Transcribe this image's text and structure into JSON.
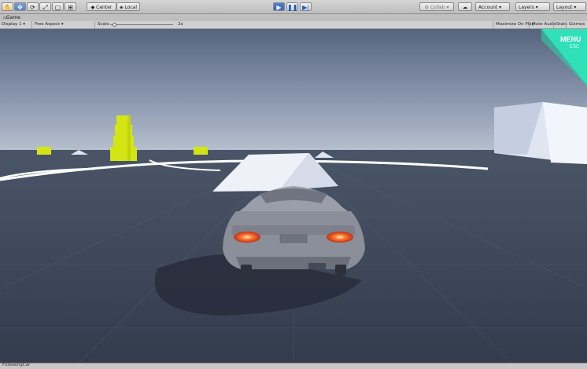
{
  "toolbar": {
    "tools": [
      "hand-tool",
      "move-tool",
      "rotate-tool",
      "scale-tool",
      "rect-tool",
      "transform-tool"
    ],
    "pivot_label": "Center",
    "space_label": "Local",
    "playback": [
      "play-button",
      "pause-button",
      "step-button"
    ],
    "collab_label": "Collab",
    "account_label": "Account",
    "layers_label": "Layers",
    "layout_label": "Layout"
  },
  "tab": {
    "title": "Game"
  },
  "game_bar": {
    "display": "Display 1",
    "aspect": "Free Aspect",
    "scale_label": "Scale",
    "scale_value": "2x",
    "maximize": "Maximize On Play",
    "mute": "Mute Audio",
    "stats": "Stats",
    "gizmos": "Gizmos"
  },
  "overlay": {
    "menu": "MENU",
    "esc": "ESC",
    "menu_color": "#2fe0b9"
  },
  "status": {
    "text": "FollowingCar"
  },
  "colors": {
    "sky_top": "#5e6b83",
    "sky_horizon": "#aeb9c9",
    "ground": "#3a4456",
    "road_line": "#ffffff",
    "yellow_blocks": "#d6e514",
    "car_body": "#8b8f99",
    "taillight": "#ff6a2e"
  }
}
